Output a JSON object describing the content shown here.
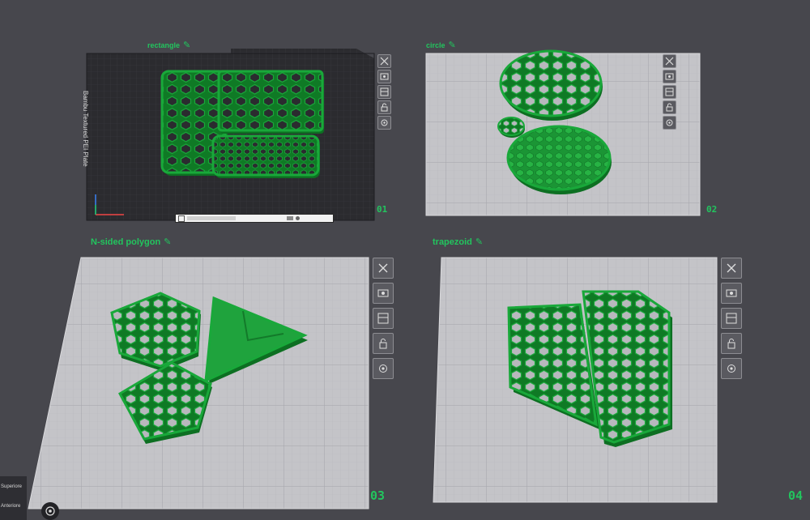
{
  "plates": [
    {
      "label": "rectangle",
      "number": "01",
      "bed_text": "Bambu Textured PEI Plate"
    },
    {
      "label": "circle",
      "number": "02"
    },
    {
      "label": "N-sided polygon",
      "number": "03"
    },
    {
      "label": "trapezoid",
      "number": "04"
    }
  ],
  "edit_glyph": "✎",
  "view_labels": {
    "top": "Superiore",
    "front": "Anteriore"
  },
  "colors": {
    "accent": "#22c55e",
    "model": "#1e9c3a",
    "model_dark": "#0d6f22",
    "plate": "#c9c9cd",
    "bed": "#2b2b2f"
  },
  "toolbar_icons": [
    "close-icon",
    "auto-orient-icon",
    "arrange-icon",
    "lock-icon",
    "settings-icon"
  ]
}
